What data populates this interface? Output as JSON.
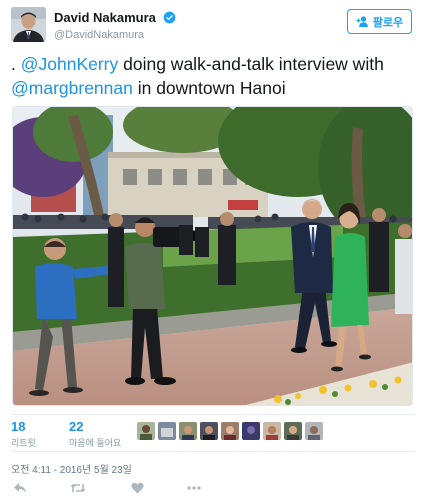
{
  "user": {
    "display_name": "David Nakamura",
    "handle": "@DavidNakamura",
    "verified_icon": "verified-badge-icon",
    "avatar_icon": "user-avatar"
  },
  "follow_button": {
    "label": "팔로우",
    "icon": "add-person-icon"
  },
  "tweet": {
    "prefix": ". ",
    "mention1": "@JohnKerry",
    "middle": " doing walk-and-talk interview with ",
    "mention2": "@margbrennan",
    "suffix": " in downtown Hanoi"
  },
  "stats": {
    "retweets": {
      "count": "18",
      "label": "리트윗"
    },
    "likes": {
      "count": "22",
      "label": "마음에 들어요"
    }
  },
  "timestamp": "오전 4:11 - 2016년 5월 23일",
  "colors": {
    "link": "#1b95e0",
    "follow": "#1da1f2",
    "muted": "#8899a6"
  }
}
